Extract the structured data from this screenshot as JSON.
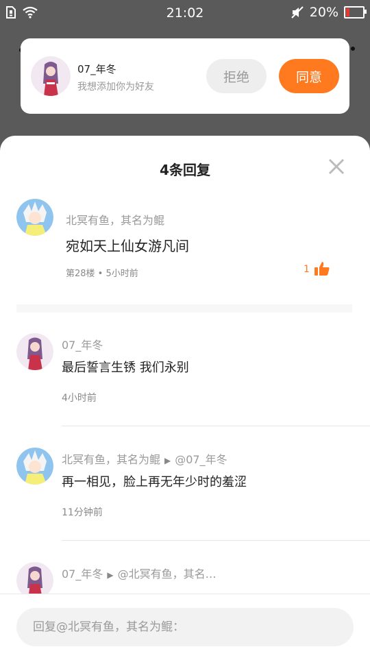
{
  "status_bar": {
    "time": "21:02",
    "battery_percent": "20%",
    "battery_level": 0.2,
    "icons": [
      "sim-icon",
      "wifi-icon",
      "mute-icon",
      "battery-icon"
    ]
  },
  "friend_request": {
    "name": "07_年冬",
    "message": "我想添加你为好友",
    "reject_label": "拒绝",
    "accept_label": "同意"
  },
  "sheet": {
    "title": "4条回复",
    "main_comment": {
      "author": "北冥有鱼，其名为鲲",
      "content": "宛如天上仙女游凡间",
      "meta": "第28楼 • 5小时前",
      "likes": "1"
    },
    "replies": [
      {
        "author": "07_年冬",
        "reply_to": "",
        "content": "最后誓言生锈 我们永别",
        "time": "4小时前"
      },
      {
        "author": "北冥有鱼，其名为鲲",
        "reply_to": "@07_年冬",
        "content": "再一相见，脸上再无年少时的羞涩",
        "time": "11分钟前"
      },
      {
        "author": "07_年冬",
        "reply_to": "@北冥有鱼，其名…",
        "content": "",
        "time": ""
      }
    ]
  },
  "reply_box": {
    "placeholder": "回复@北冥有鱼，其名为鲲："
  },
  "colors": {
    "accent": "#ff7a1f",
    "overlay": "#5a5a5a",
    "battery_low": "#e53935"
  }
}
